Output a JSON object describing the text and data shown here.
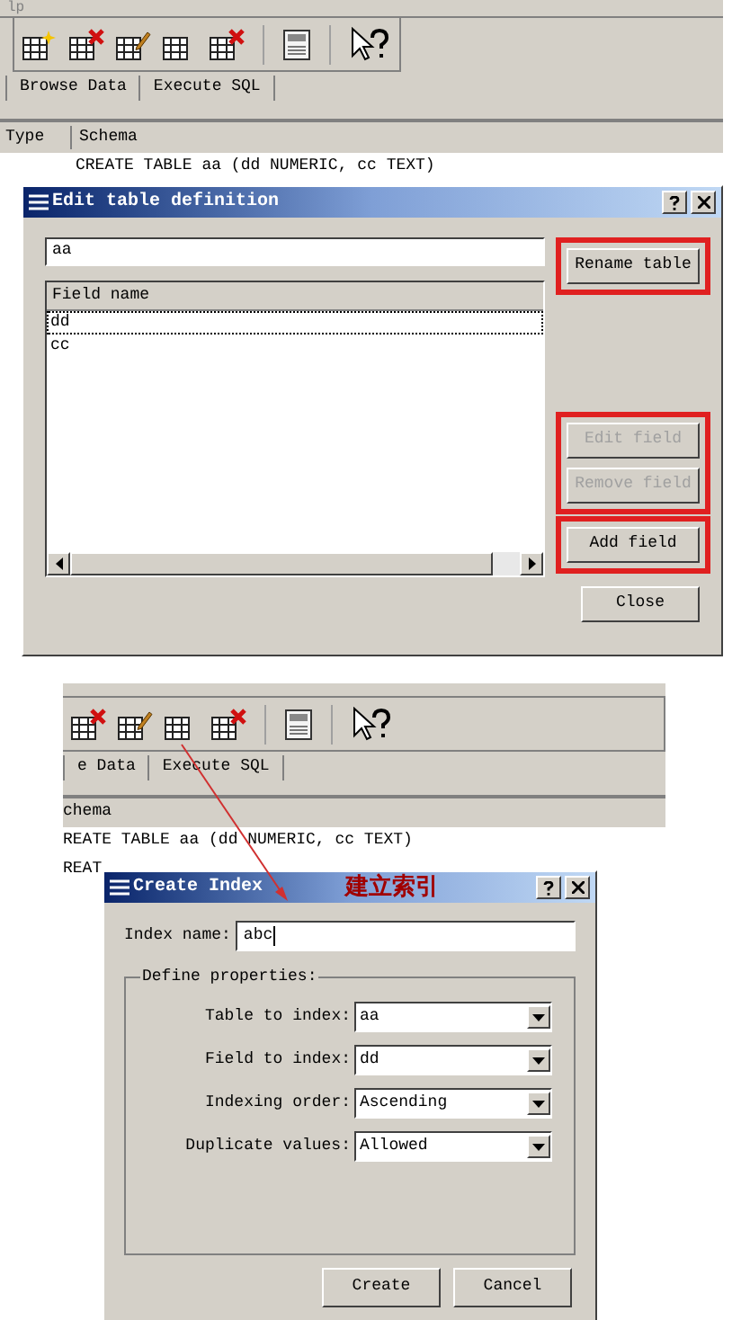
{
  "top_window": {
    "menu_fragment": "lp",
    "tabs": [
      {
        "label": "Browse Data"
      },
      {
        "label": "Execute SQL"
      }
    ],
    "columns": [
      "Type",
      "Schema"
    ],
    "row": "CREATE TABLE aa (dd NUMERIC, cc TEXT)"
  },
  "edit_table_dialog": {
    "title": "Edit table definition",
    "table_name": "aa",
    "list": {
      "header": "Field name",
      "rows": [
        {
          "name": "dd",
          "selected": true
        },
        {
          "name": "cc",
          "selected": false
        }
      ]
    },
    "button_groups": [
      {
        "highlighted": true,
        "buttons": [
          {
            "label": "Rename table",
            "disabled": false
          }
        ]
      },
      {
        "highlighted": true,
        "buttons": [
          {
            "label": "Edit field",
            "disabled": true
          },
          {
            "label": "Remove field",
            "disabled": true
          }
        ]
      },
      {
        "highlighted": true,
        "buttons": [
          {
            "label": "Add field",
            "disabled": false
          }
        ]
      },
      {
        "highlighted": false,
        "buttons": [
          {
            "label": "Close",
            "disabled": false
          }
        ]
      }
    ]
  },
  "second_window": {
    "tabs": [
      {
        "label": "e Data"
      },
      {
        "label": "Execute SQL"
      }
    ],
    "column": "chema",
    "row": "REATE TABLE aa (dd NUMERIC, cc TEXT)",
    "row_fragment": "REAT"
  },
  "create_index_dialog": {
    "title": "Create Index",
    "annotation": "建立索引",
    "index_name_label": "Index name:",
    "index_name_value": "abc",
    "group_title": "Define properties:",
    "fields": [
      {
        "label": "Table to index:",
        "value": "aa"
      },
      {
        "label": "Field to index:",
        "value": "dd"
      },
      {
        "label": "Indexing order:",
        "value": "Ascending"
      },
      {
        "label": "Duplicate values:",
        "value": "Allowed"
      }
    ],
    "buttons": [
      "Create",
      "Cancel"
    ]
  }
}
